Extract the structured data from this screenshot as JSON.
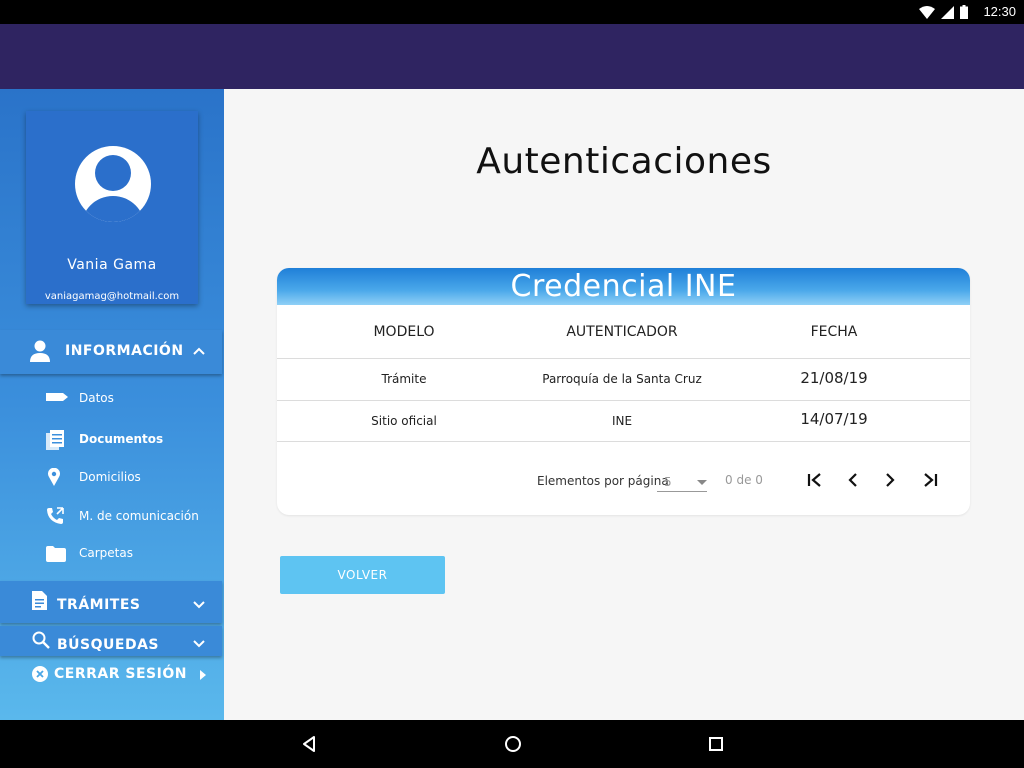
{
  "status_bar": {
    "time": "12:30"
  },
  "profile": {
    "name": "Vania Gama",
    "email": "vaniagamag@hotmail.com"
  },
  "sidebar": {
    "informacion": {
      "label": "INFORMACIÓN",
      "expanded": true
    },
    "items": [
      {
        "label": "Datos",
        "icon": "tag-icon"
      },
      {
        "label": "Documentos",
        "icon": "documents-icon",
        "active": true
      },
      {
        "label": "Domicilios",
        "icon": "location-pin-icon"
      },
      {
        "label": "M. de comunicación",
        "icon": "phone-icon"
      },
      {
        "label": "Carpetas",
        "icon": "folder-icon"
      }
    ],
    "tramites": {
      "label": "TRÁMITES"
    },
    "busquedas": {
      "label": "BÚSQUEDAS"
    },
    "logout": {
      "label": "CERRAR SESIÓN"
    }
  },
  "main": {
    "title": "Autenticaciones",
    "card": {
      "header": "Credencial INE",
      "columns": [
        "MODELO",
        "AUTENTICADOR",
        "FECHA"
      ],
      "rows": [
        {
          "modelo": "Trámite",
          "autenticador": "Parroquía de la Santa Cruz",
          "fecha": "21/08/19"
        },
        {
          "modelo": "Sitio oficial",
          "autenticador": "INE",
          "fecha": "14/07/19"
        }
      ],
      "paginator": {
        "label": "Elementos por página",
        "page_size": "5",
        "range": "0 de 0"
      }
    },
    "back_button": "VOLVER"
  },
  "colors": {
    "appbar": "#2f2461",
    "sidebar_top": "#2a73c9",
    "sidebar_bottom": "#5ab8ec",
    "button": "#5ec4f2"
  }
}
